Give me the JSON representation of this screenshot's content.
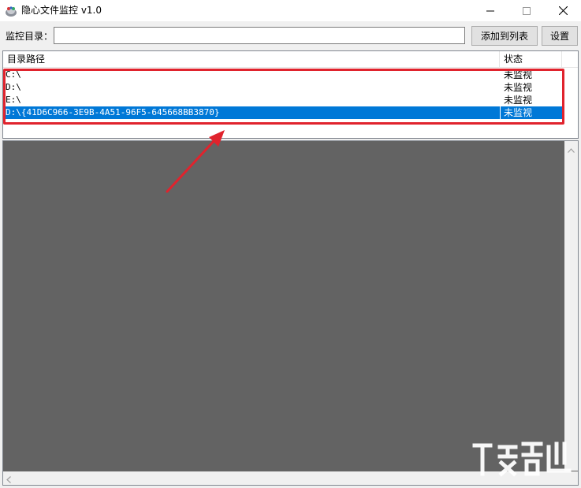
{
  "window": {
    "title": "隐心文件监控 v1.0",
    "icon": "app-icon",
    "controls": [
      "minimize-icon",
      "maximize-icon",
      "close-icon"
    ]
  },
  "toolbar": {
    "dir_label": "监控目录：",
    "dir_value": "",
    "add_label": "添加到列表",
    "settings_label": "设置"
  },
  "list": {
    "columns": [
      "目录路径",
      "状态"
    ],
    "rows": [
      {
        "path": "C:\\",
        "status": "未监视"
      },
      {
        "path": "D:\\",
        "status": "未监视"
      },
      {
        "path": "E:\\",
        "status": "未监视"
      },
      {
        "path": "D:\\{41D6C966-3E9B-4A51-96F5-645668BB3870}",
        "status": "未监视",
        "selected": true
      }
    ]
  },
  "colors": {
    "selection": "#0078d7",
    "annotation": "#e0232d",
    "output_bg": "#636363"
  },
  "watermark": {
    "icon": "download-site-logo"
  }
}
